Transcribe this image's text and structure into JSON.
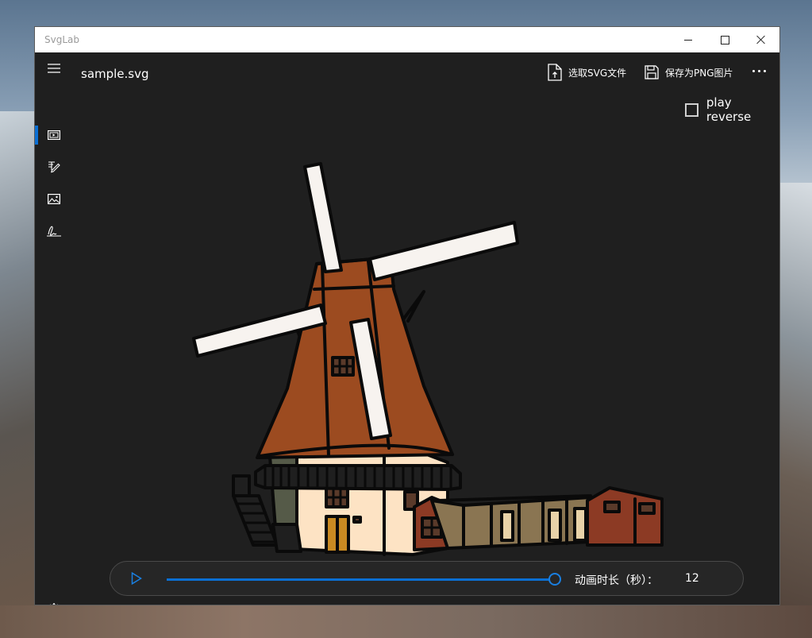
{
  "window": {
    "title": "SvgLab"
  },
  "document": {
    "title": "sample.svg"
  },
  "toolbar": {
    "open_label": "选取SVG文件",
    "save_label": "保存为PNG图片",
    "more_icon": "more-icon"
  },
  "nav": {
    "items": [
      {
        "name": "preview",
        "icon": "player-icon",
        "selected": true
      },
      {
        "name": "edit",
        "icon": "edit-icon",
        "selected": false
      },
      {
        "name": "image",
        "icon": "image-icon",
        "selected": false
      },
      {
        "name": "draw",
        "icon": "signature-icon",
        "selected": false
      }
    ],
    "settings_icon": "gear-icon"
  },
  "options": {
    "play_reverse_label": "play reverse",
    "play_reverse_checked": false
  },
  "player": {
    "play_icon": "play-icon",
    "progress": 1.0,
    "duration_label": "动画时长（秒）：",
    "duration_value": "12"
  },
  "colors": {
    "accent": "#0b6fd3",
    "background": "#1f1f1f"
  }
}
